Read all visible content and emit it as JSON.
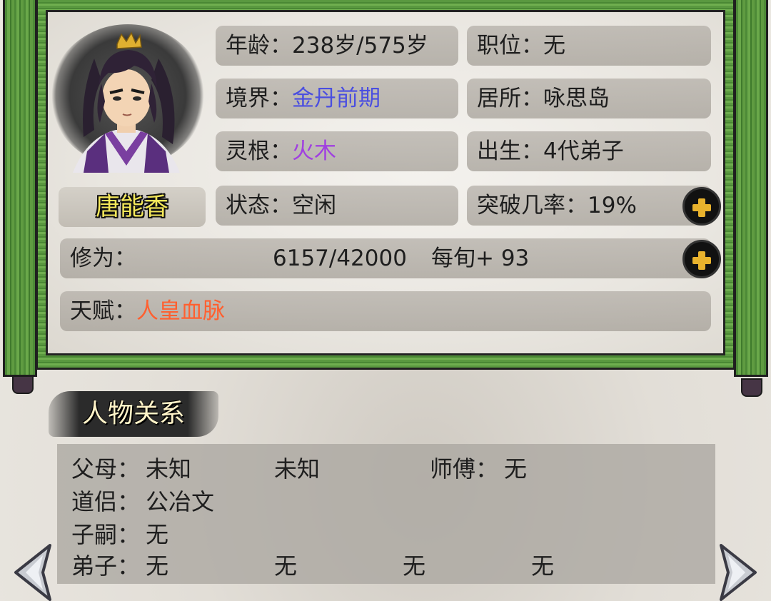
{
  "character": {
    "name": "唐能香"
  },
  "stats": {
    "age_label": "年龄：",
    "age_value": "238岁/575岁",
    "position_label": "职位：",
    "position_value": "无",
    "realm_label": "境界：",
    "realm_value": "金丹前期",
    "residence_label": "居所：",
    "residence_value": "咏思岛",
    "spirit_root_label": "灵根：",
    "spirit_root_value": "火木",
    "birth_label": "出生：",
    "birth_value": "4代弟子",
    "status_label": "状态：",
    "status_value": "空闲",
    "breakthrough_label": "突破几率：",
    "breakthrough_value": "19%",
    "cultivation_label": "修为：",
    "cultivation_value": "6157/42000",
    "cultivation_rate": "每旬+ 93",
    "talent_label": "天赋：",
    "talent_value": "人皇血脉"
  },
  "relations": {
    "tab_label": "人物关系",
    "parents_label": "父母：",
    "parent1": "未知",
    "parent2": "未知",
    "master_label": "师傅：",
    "master_value": "无",
    "partner_label": "道侣：",
    "partner_value": "公冶文",
    "children_label": "子嗣：",
    "children_value": "无",
    "disciples_label": "弟子：",
    "disciple1": "无",
    "disciple2": "无",
    "disciple3": "无",
    "disciple4": "无"
  },
  "colors": {
    "realm": "#4a4ee0",
    "spirit_root": "#a040e0",
    "talent": "#ff6030",
    "name": "#f4e85a",
    "plus_icon": "#e8b22d",
    "frame_green": "#5a9940"
  },
  "icons": {
    "add_breakthrough": "plus-icon",
    "add_cultivation": "plus-icon",
    "prev": "arrow-left-icon",
    "next": "arrow-right-icon"
  }
}
